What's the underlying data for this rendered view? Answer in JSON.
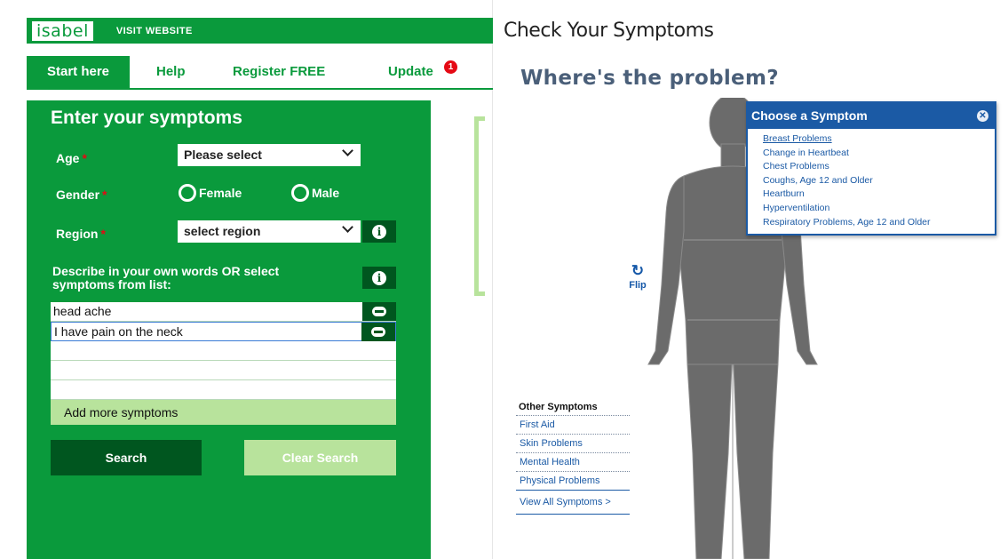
{
  "isabel": {
    "logo": "isabel",
    "visit_website": "VISIT WEBSITE",
    "nav": {
      "start": "Start here",
      "help": "Help",
      "register": "Register FREE",
      "update": "Update",
      "update_badge": "1"
    },
    "form": {
      "title": "Enter your symptoms",
      "age_label": "Age",
      "age_value": "Please select",
      "gender_label": "Gender",
      "gender_female": "Female",
      "gender_male": "Male",
      "region_label": "Region",
      "region_value": "select region",
      "required_mark": "*",
      "info_glyph": "i",
      "describe": "Describe in your own words OR select symptoms from list:",
      "symptoms": [
        "head ache",
        "I have pain on the neck",
        "",
        "",
        ""
      ],
      "add_more": "Add more symptoms",
      "search": "Search",
      "clear": "Clear Search"
    }
  },
  "checker": {
    "title": "Check Your Symptoms",
    "question": "Where's the problem?",
    "flip_label": "Flip",
    "popup": {
      "title": "Choose a Symptom",
      "items": [
        "Breast Problems",
        "Change in Heartbeat",
        "Chest Problems",
        "Coughs, Age 12 and Older",
        "Heartburn",
        "Hyperventilation",
        "Respiratory Problems, Age 12 and Older"
      ]
    },
    "other": {
      "heading": "Other Symptoms",
      "items": [
        "First Aid",
        "Skin Problems",
        "Mental Health",
        "Physical Problems"
      ],
      "view_all": "View All Symptoms >"
    }
  },
  "colors": {
    "isabel_green": "#0a9a3c",
    "isabel_dark_green": "#00561f",
    "isabel_light_green": "#b8e39c",
    "checker_blue": "#1b5aa5",
    "figure_gray": "#6b6b6b"
  }
}
